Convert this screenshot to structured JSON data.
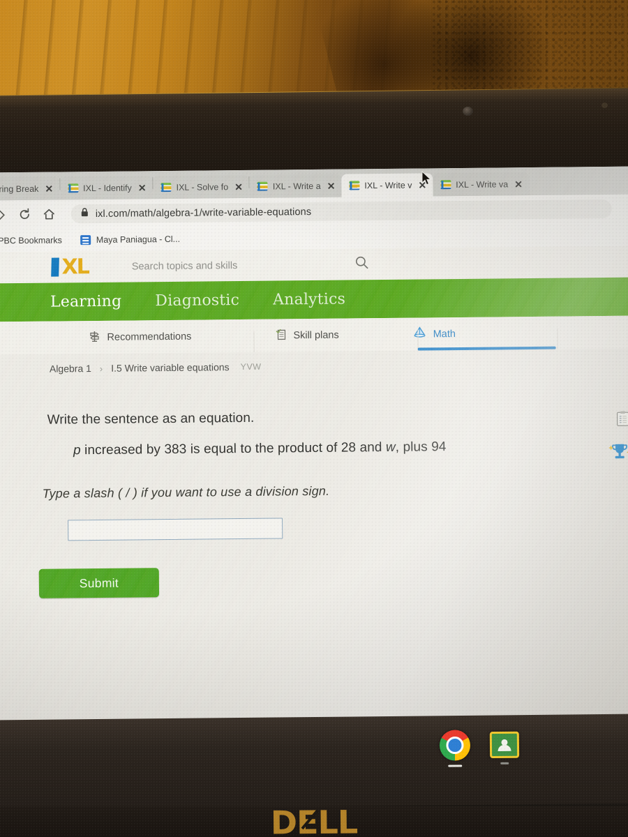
{
  "browser": {
    "tabs": [
      {
        "title": "pring Break",
        "icon": "ixl-favicon",
        "state": "partial"
      },
      {
        "title": "IXL - Identify",
        "icon": "ixl-favicon",
        "state": "inactive"
      },
      {
        "title": "IXL - Solve fo",
        "icon": "ixl-favicon",
        "state": "inactive"
      },
      {
        "title": "IXL - Write a",
        "icon": "ixl-favicon",
        "state": "inactive"
      },
      {
        "title": "IXL - Write v",
        "icon": "ixl-favicon",
        "state": "active"
      },
      {
        "title": "IXL - Write va",
        "icon": "ixl-favicon",
        "state": "inactive"
      }
    ],
    "close_label": "✕",
    "nav": {
      "forward_icon": "chevron-right-icon",
      "reload_icon": "reload-icon",
      "home_icon": "home-icon",
      "lock_icon": "lock-icon"
    },
    "url": "ixl.com/math/algebra-1/write-variable-equations",
    "bookmarks": [
      {
        "label": "PBC Bookmarks",
        "icon": "folder-icon"
      },
      {
        "label": "Maya Paniagua - Cl...",
        "icon": "doc-icon"
      }
    ]
  },
  "ixl": {
    "logo": {
      "mark": "I",
      "text": "XL",
      "blue": "#1278be",
      "gold": "#e3ab18"
    },
    "search": {
      "placeholder": "Search topics and skills",
      "icon": "search-icon"
    },
    "nav": [
      {
        "label": "Learning"
      },
      {
        "label": "Diagnostic"
      },
      {
        "label": "Analytics"
      }
    ],
    "subtabs": [
      {
        "label": "Recommendations",
        "icon": "signpost-icon",
        "active": false
      },
      {
        "label": "Skill plans",
        "icon": "checklist-icon",
        "active": false
      },
      {
        "label": "Math",
        "icon": "pyramid-icon",
        "active": true
      }
    ],
    "right_icons": [
      {
        "name": "clipboard-icon"
      },
      {
        "name": "trophy-icon"
      }
    ],
    "accent_green": "#5aa81f",
    "accent_blue": "#2e86c8",
    "breadcrumb": {
      "subject": "Algebra 1",
      "separator": "›",
      "skill": "I.5 Write variable equations",
      "code": "YVW"
    },
    "question": {
      "prompt": "Write the sentence as an equation.",
      "sentence_parts": [
        {
          "text": "p",
          "italic": true
        },
        {
          "text": " increased by 383 is equal to the product of 28 and ",
          "italic": false
        },
        {
          "text": "w",
          "italic": true
        },
        {
          "text": ", plus 94",
          "italic": false
        }
      ],
      "sentence_plain": "p increased by 383 is equal to the product of 28 and w, plus 94",
      "hint": "Type a slash ( / ) if you want to use a division sign.",
      "answer_value": "",
      "submit_label": "Submit"
    }
  },
  "shelf": {
    "items": [
      {
        "name": "chrome-icon",
        "running": true
      },
      {
        "name": "google-classroom-icon",
        "running": true
      }
    ]
  },
  "device": {
    "brand": "DELL"
  }
}
